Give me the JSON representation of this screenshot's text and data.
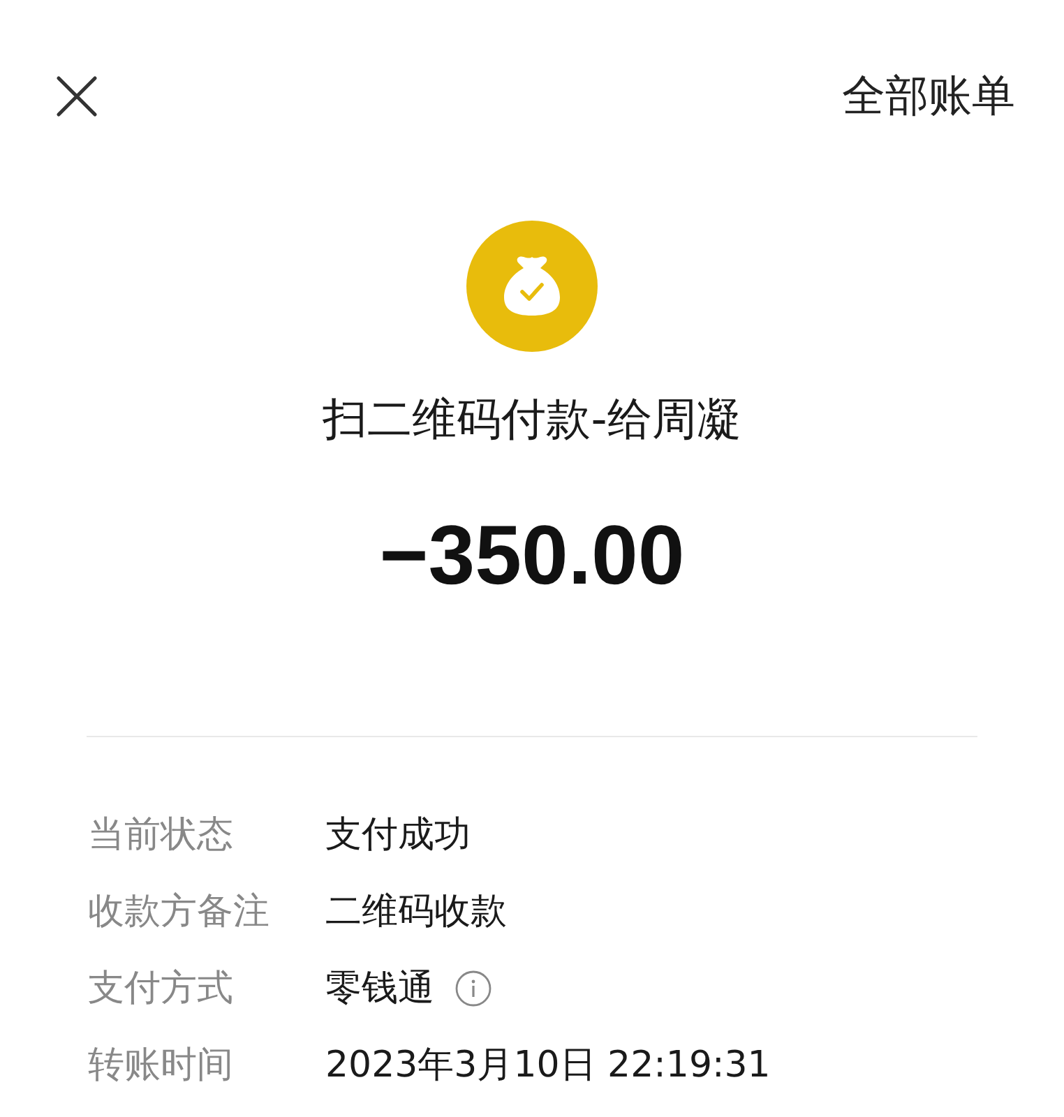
{
  "header": {
    "link": "全部账单"
  },
  "payment": {
    "title": "扫二维码付款-给周凝",
    "amount": "−350.00"
  },
  "details": [
    {
      "label": "当前状态",
      "value": "支付成功",
      "kind": "text"
    },
    {
      "label": "收款方备注",
      "value": "二维码收款",
      "kind": "text"
    },
    {
      "label": "支付方式",
      "value": "零钱通",
      "kind": "info"
    },
    {
      "label": "转账时间",
      "value": "2023年3月10日 22:19:31",
      "kind": "text"
    }
  ]
}
